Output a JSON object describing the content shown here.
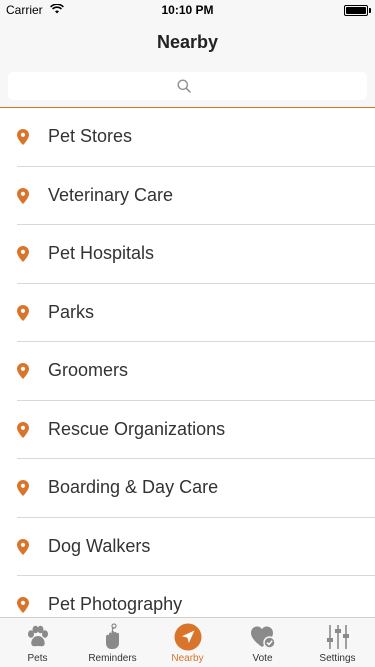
{
  "status_bar": {
    "carrier": "Carrier",
    "time": "10:10 PM"
  },
  "nav": {
    "title": "Nearby"
  },
  "search": {
    "placeholder": ""
  },
  "colors": {
    "accent": "#d9742b",
    "icon_gray": "#8a8a8a"
  },
  "list": {
    "items": [
      {
        "label": "Pet Stores",
        "icon": "map-pin-icon"
      },
      {
        "label": "Veterinary Care",
        "icon": "map-pin-icon"
      },
      {
        "label": "Pet Hospitals",
        "icon": "map-pin-icon"
      },
      {
        "label": "Parks",
        "icon": "map-pin-icon"
      },
      {
        "label": "Groomers",
        "icon": "map-pin-icon"
      },
      {
        "label": "Rescue Organizations",
        "icon": "map-pin-icon"
      },
      {
        "label": "Boarding & Day Care",
        "icon": "map-pin-icon"
      },
      {
        "label": "Dog Walkers",
        "icon": "map-pin-icon"
      },
      {
        "label": "Pet Photography",
        "icon": "map-pin-icon"
      }
    ]
  },
  "tabs": [
    {
      "label": "Pets",
      "icon": "paw-icon",
      "active": false
    },
    {
      "label": "Reminders",
      "icon": "hand-reminder-icon",
      "active": false
    },
    {
      "label": "Nearby",
      "icon": "navigation-arrow-icon",
      "active": true
    },
    {
      "label": "Vote",
      "icon": "heart-check-icon",
      "active": false
    },
    {
      "label": "Settings",
      "icon": "sliders-icon",
      "active": false
    }
  ]
}
